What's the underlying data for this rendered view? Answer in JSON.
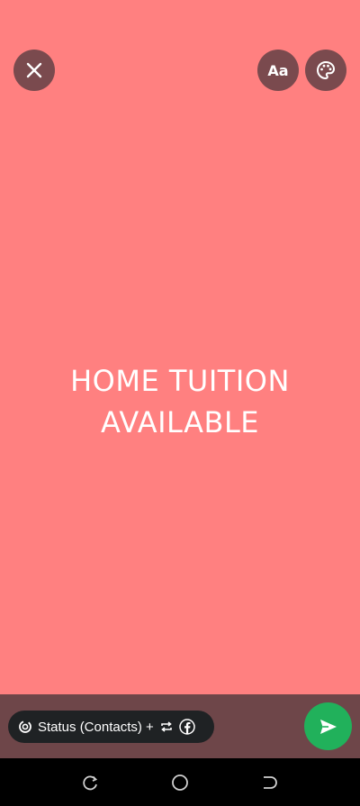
{
  "status_text": {
    "line1": "HOME TUITION",
    "line2": "AVAILABLE"
  },
  "toolbar": {
    "font_button_label": "Aa"
  },
  "audience": {
    "label": "Status (Contacts) +"
  },
  "colors": {
    "background": "#ff8080",
    "bottom_bar": "#6e4649",
    "send_button": "#21b15b",
    "chip": "#1f2224"
  },
  "icons": {
    "close": "close-icon",
    "palette": "palette-icon",
    "status": "status-icon",
    "repeat": "repeat-icon",
    "facebook": "facebook-icon",
    "send": "send-icon"
  }
}
